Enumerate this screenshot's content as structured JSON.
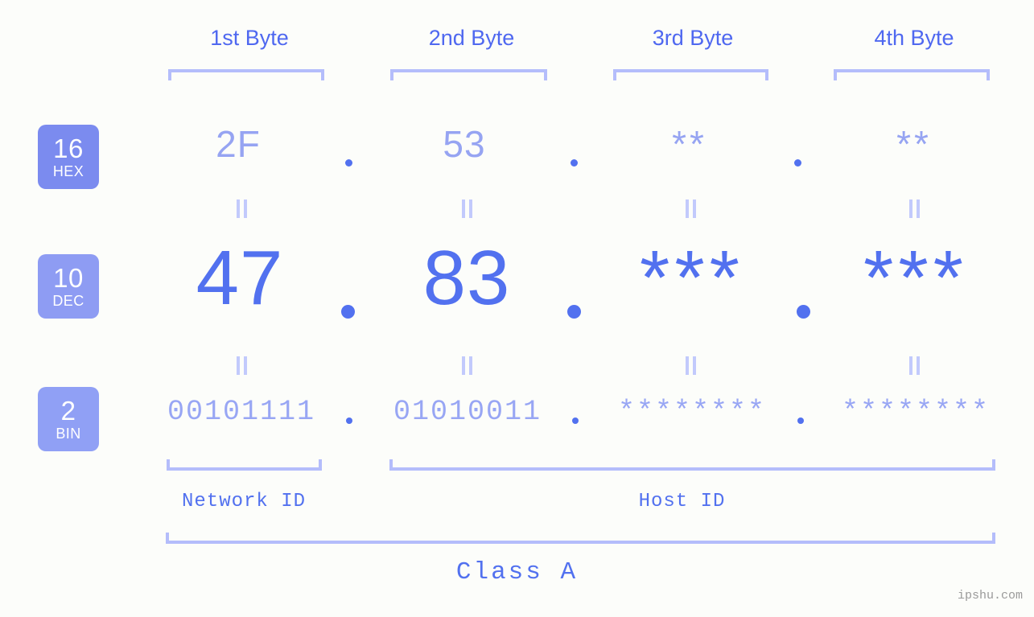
{
  "page": {
    "background_color": "#fcfdfa",
    "accent_color": "#5271ef",
    "accent_light_color": "#b4bdfb",
    "badge_color": "#7b8bef"
  },
  "header": {
    "byte_labels": [
      "1st Byte",
      "2nd Byte",
      "3rd Byte",
      "4th Byte"
    ]
  },
  "rows": {
    "hex": {
      "badge_number": "16",
      "badge_name": "HEX",
      "values": [
        "2F",
        "53",
        "**",
        "**"
      ],
      "separator": "."
    },
    "dec": {
      "badge_number": "10",
      "badge_name": "DEC",
      "values": [
        "47",
        "83",
        "***",
        "***"
      ],
      "separator": "."
    },
    "bin": {
      "badge_number": "2",
      "badge_name": "BIN",
      "values": [
        "00101111",
        "01010011",
        "********",
        "********"
      ],
      "separator": "."
    }
  },
  "equivalence_marker": "=",
  "footer": {
    "network_id_label": "Network ID",
    "host_id_label": "Host ID",
    "class_label": "Class A"
  },
  "watermark": "ipshu.com"
}
